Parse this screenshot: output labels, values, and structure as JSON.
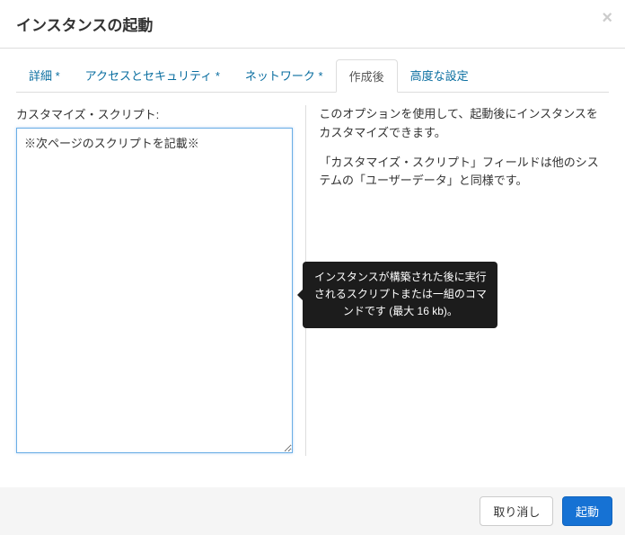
{
  "header": {
    "title": "インスタンスの起動"
  },
  "tabs": [
    {
      "label": "詳細 *"
    },
    {
      "label": "アクセスとセキュリティ *"
    },
    {
      "label": "ネットワーク *"
    },
    {
      "label": "作成後"
    },
    {
      "label": "高度な設定"
    }
  ],
  "form": {
    "script_label": "カスタマイズ・スクリプト:",
    "script_value": "※次ページのスクリプトを記載※"
  },
  "help": {
    "p1": "このオプションを使用して、起動後にインスタンスをカスタマイズできます。",
    "p2": "「カスタマイズ・スクリプト」フィールドは他のシステムの「ユーザーデータ」と同様です。"
  },
  "tooltip": {
    "text": "インスタンスが構築された後に実行されるスクリプトまたは一組のコマンドです (最大 16 kb)。"
  },
  "footer": {
    "cancel": "取り消し",
    "launch": "起動"
  }
}
